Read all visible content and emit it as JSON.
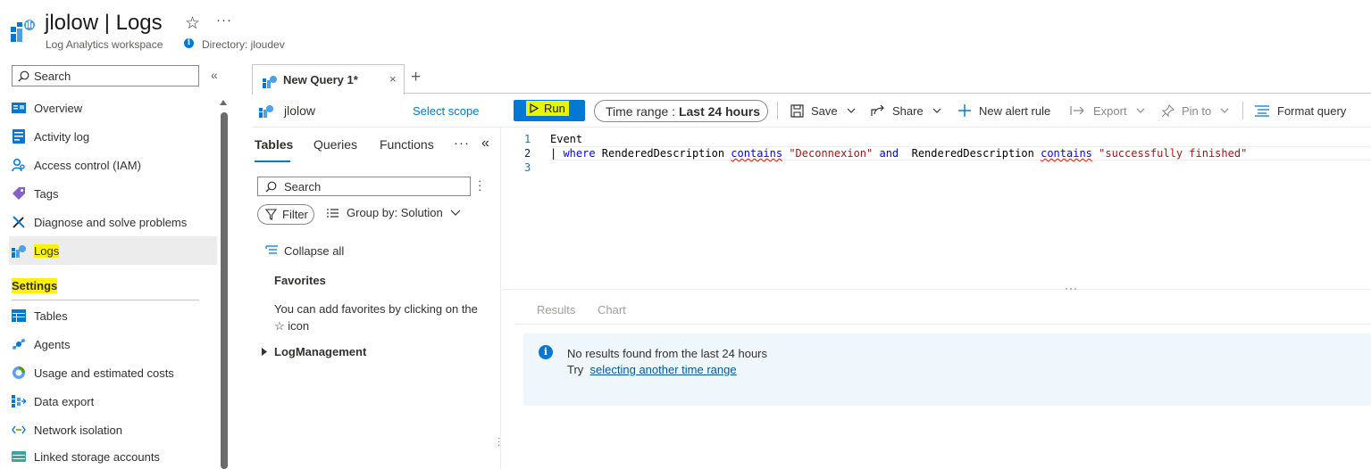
{
  "header": {
    "title": "jlolow | Logs",
    "subtitle": "Log Analytics workspace",
    "directory": "Directory: jloudev",
    "favorite_icon": "star-icon",
    "more_icon": "more-icon"
  },
  "nav": {
    "search_placeholder": "Search",
    "items": [
      {
        "label": "Overview",
        "icon": "overview-icon"
      },
      {
        "label": "Activity log",
        "icon": "activity-log-icon"
      },
      {
        "label": "Access control (IAM)",
        "icon": "iam-icon"
      },
      {
        "label": "Tags",
        "icon": "tag-icon"
      },
      {
        "label": "Diagnose and solve problems",
        "icon": "wrench-icon"
      },
      {
        "label": "Logs",
        "icon": "logs-icon",
        "active": true
      }
    ],
    "settings_header": "Settings",
    "settings_items": [
      {
        "label": "Tables",
        "icon": "table-icon"
      },
      {
        "label": "Agents",
        "icon": "agents-icon"
      },
      {
        "label": "Usage and estimated costs",
        "icon": "usage-icon"
      },
      {
        "label": "Data export",
        "icon": "export-icon"
      },
      {
        "label": "Network isolation",
        "icon": "network-icon"
      },
      {
        "label": "Linked storage accounts",
        "icon": "storage-icon"
      }
    ]
  },
  "query_tab": {
    "label": "New Query 1*",
    "close": "×",
    "add": "+"
  },
  "toolbar": {
    "scope_name": "jlolow",
    "select_scope": "Select scope",
    "run": "Run",
    "time_range_label": "Time range :",
    "time_range_value": "Last 24 hours",
    "save": "Save",
    "share": "Share",
    "new_alert_rule": "New alert rule",
    "export": "Export",
    "pin_to": "Pin to",
    "format_query": "Format query"
  },
  "schema": {
    "tabs": [
      "Tables",
      "Queries",
      "Functions"
    ],
    "selected_tab": "Tables",
    "search_placeholder": "Search",
    "filter": "Filter",
    "group_by": "Group by: Solution",
    "collapse_all": "Collapse all",
    "favorites_title": "Favorites",
    "favorites_text": "You can add favorites by clicking on the ☆ icon",
    "log_management": "LogManagement"
  },
  "editor": {
    "line_numbers": [
      "1",
      "2",
      "3"
    ],
    "line1": "Event",
    "line2_pipe": "| ",
    "line2_where": "where",
    "line2_field1": " RenderedDescription ",
    "line2_contains1": "contains",
    "line2_str1": " \"Deconnexion\" ",
    "line2_and": "and",
    "line2_field2": "  RenderedDescription ",
    "line2_contains2": "contains",
    "line2_str2": " \"successfully finished\"",
    "line3": ""
  },
  "results": {
    "tabs": [
      "Results",
      "Chart"
    ],
    "message_title": "No results found from the last 24 hours",
    "message_try": "Try",
    "message_link": "selecting another time range"
  },
  "colors": {
    "accent": "#0078d4",
    "highlight": "#fff300",
    "info_bg": "#eff6fc"
  }
}
